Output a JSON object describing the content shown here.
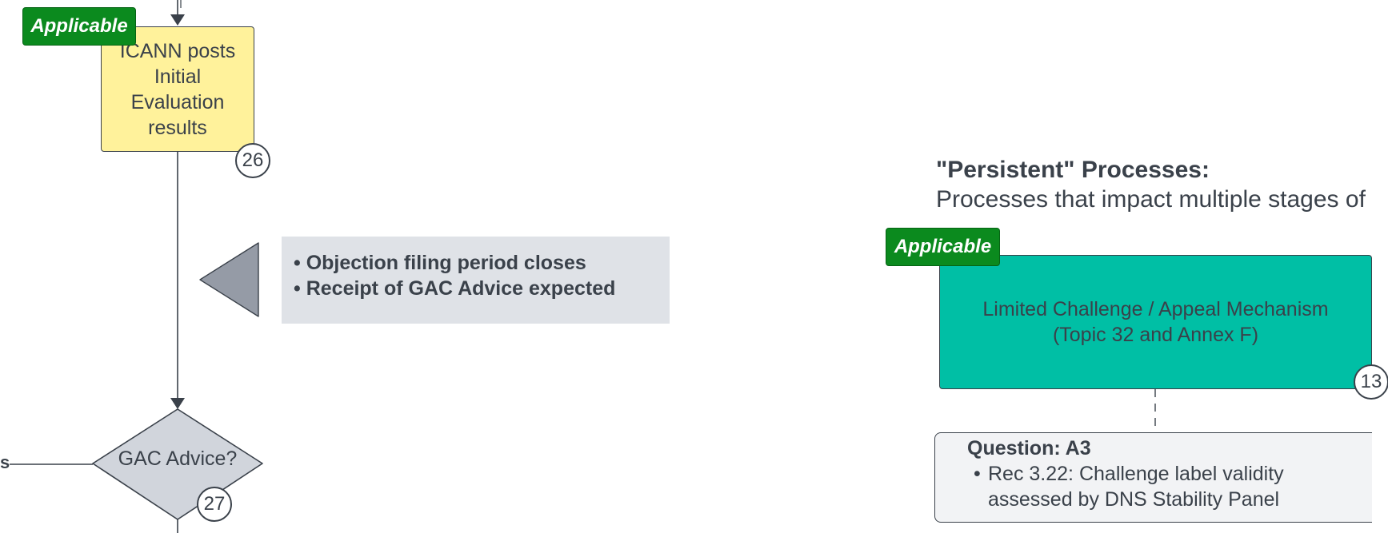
{
  "colors": {
    "applicable_badge": "#0b8a1e",
    "process_box": "#fff29b",
    "persistent_box": "#00bfa5",
    "decision_diamond": "#d1d5dc",
    "milestone_note": "#dfe2e7",
    "question_card": "#f2f3f5",
    "line": "#3a414a"
  },
  "left_flow": {
    "applicable_badge": "Applicable",
    "step_26": {
      "text": "ICANN posts Initial Evaluation results",
      "number": "26"
    },
    "milestones": [
      "Objection filing period closes",
      "Receipt of GAC Advice expected"
    ],
    "step_27": {
      "text": "GAC Advice?",
      "number": "27"
    },
    "edge_label_fragment": "s"
  },
  "persistent": {
    "title": "\"Persistent\" Processes:",
    "subtitle": "Processes that impact multiple stages of",
    "applicable_badge": "Applicable",
    "process_13": {
      "line1": "Limited Challenge / Appeal Mechanism",
      "line2": "(Topic 32 and Annex F)",
      "number": "13"
    },
    "question": {
      "title": "Question: A3",
      "items": [
        "Rec 3.22: Challenge label validity assessed by DNS Stability Panel"
      ]
    }
  }
}
